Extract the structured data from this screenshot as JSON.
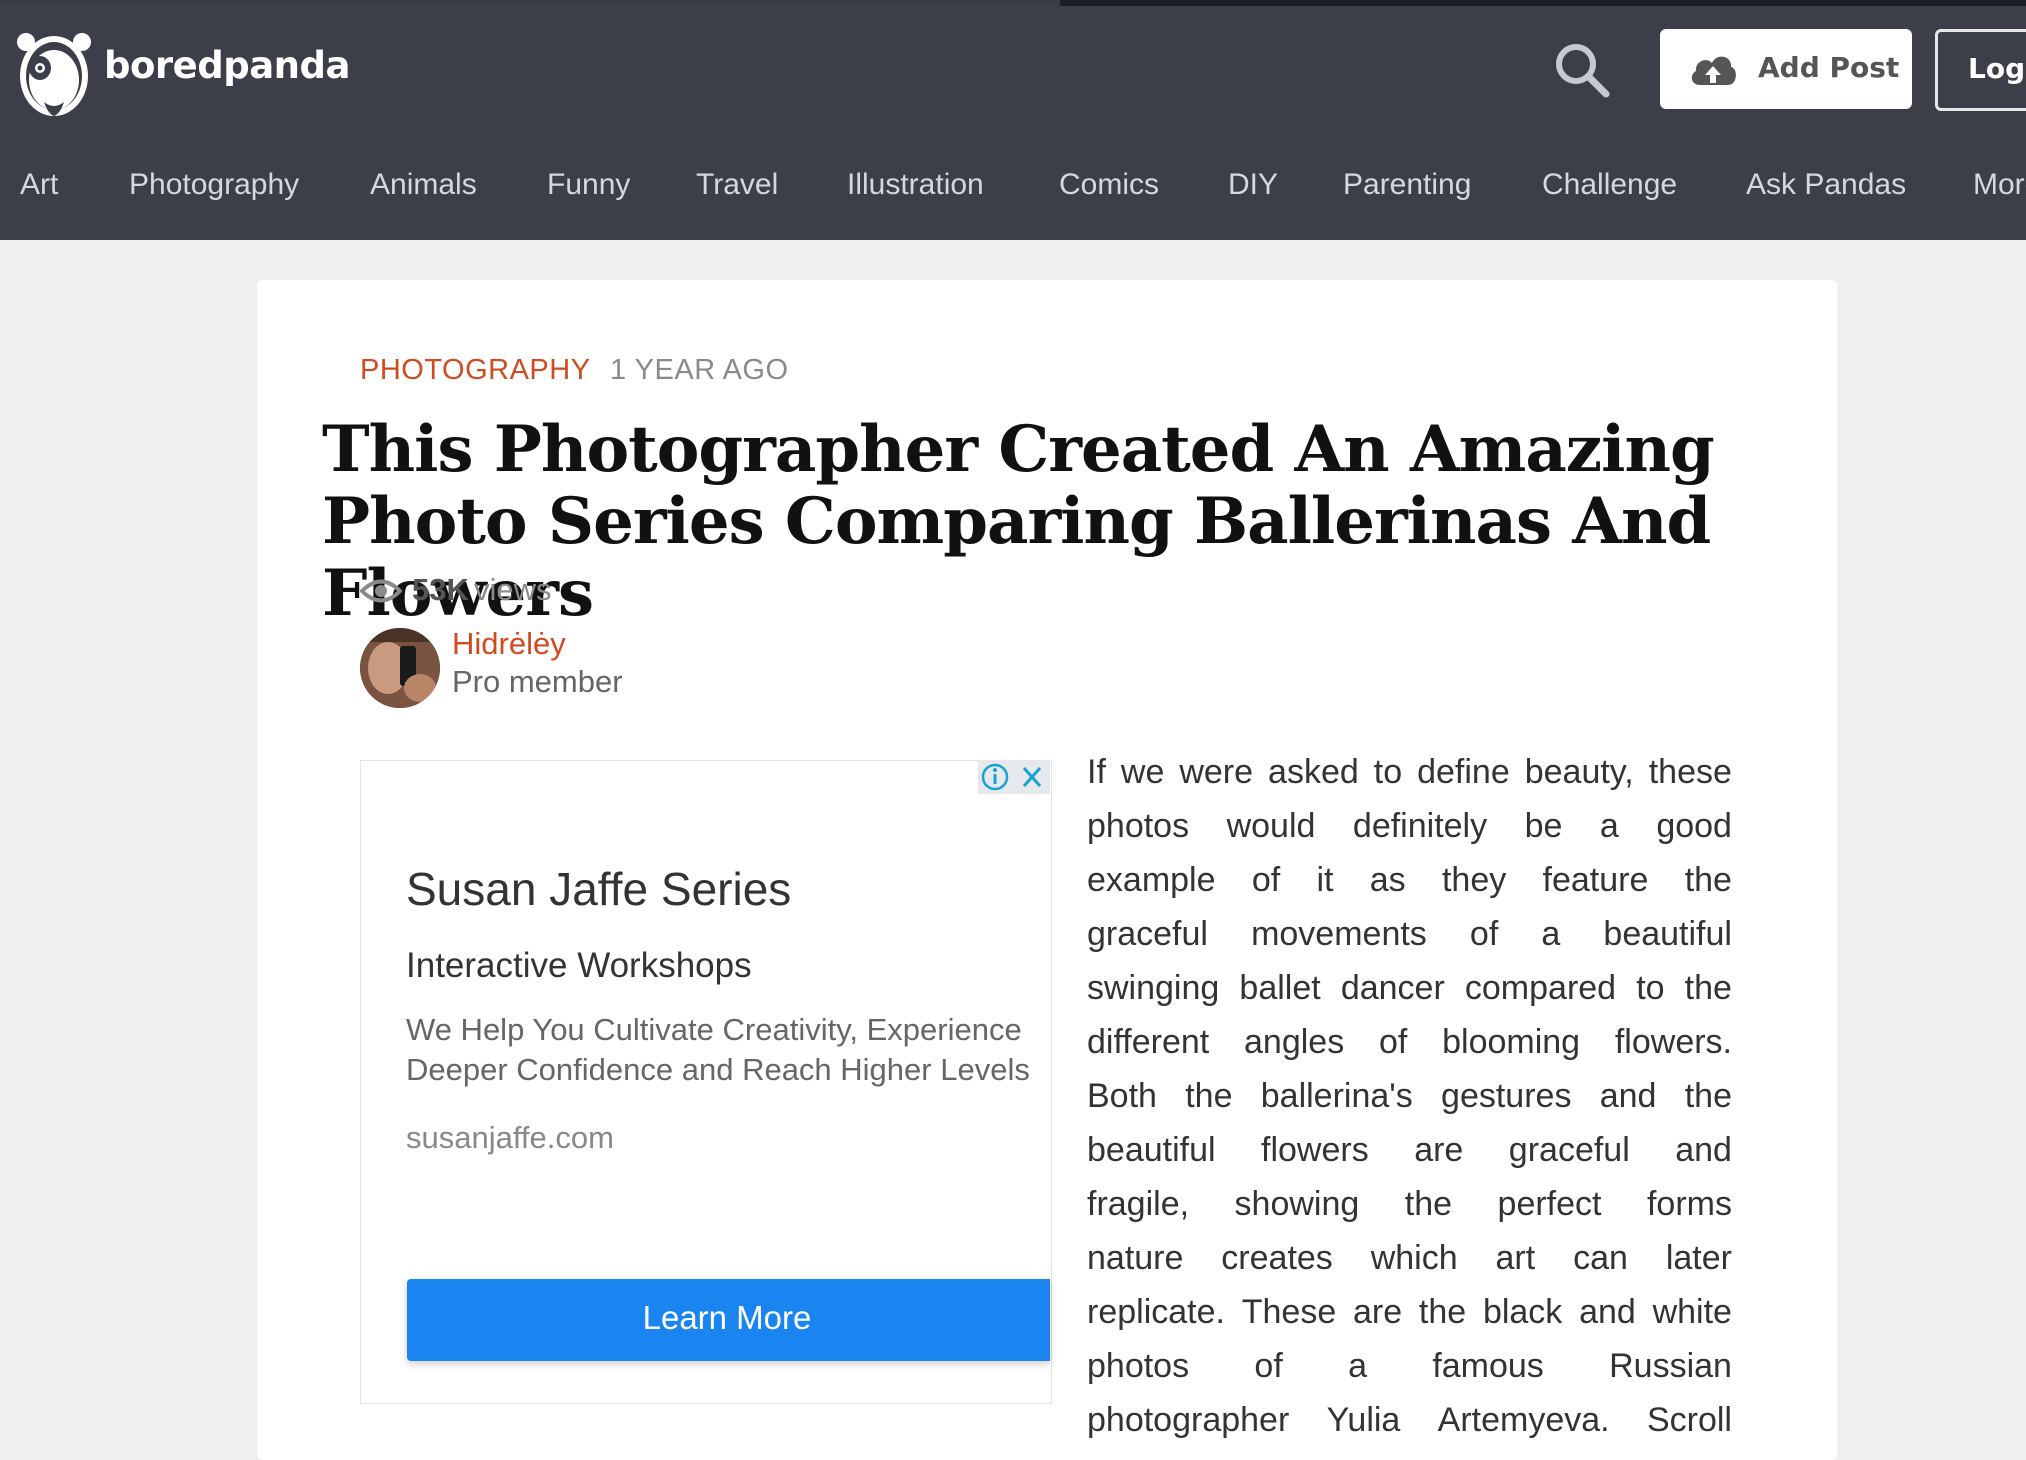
{
  "brand": {
    "name": "boredpanda"
  },
  "header": {
    "add_post_label": "Add Post",
    "login_label": "Login"
  },
  "nav": {
    "items": [
      "Art",
      "Photography",
      "Animals",
      "Funny",
      "Travel",
      "Illustration",
      "Comics",
      "DIY",
      "Parenting",
      "Challenge",
      "Ask Pandas",
      "More"
    ]
  },
  "article": {
    "category": "PHOTOGRAPHY",
    "time_ago": "1 YEAR AGO",
    "title": "This Photographer Created An Amazing Photo Series Comparing Ballerinas And Flowers",
    "views_count": "53K",
    "views_label": "views",
    "author_name": "Hidrėlėy",
    "author_role": "Pro member",
    "body_lines": [
      "If we were asked to define beauty, these",
      "photos would definitely be a good",
      "example of it as they feature the",
      "graceful movements of a beautiful",
      "swinging ballet dancer compared to the",
      "different angles of blooming flowers.",
      "Both the ballerina's gestures and the",
      "beautiful flowers are graceful and",
      "fragile, showing the perfect forms",
      "nature creates which art can later",
      "replicate. These are the black and white",
      "photos of a famous Russian",
      "photographer Yulia Artemyeva. Scroll"
    ]
  },
  "ad": {
    "title": "Susan Jaffe Series",
    "subtitle": "Interactive Workshops",
    "desc_line1": "We Help You Cultivate Creativity, Experience",
    "desc_line2": "Deeper Confidence and Reach Higher Levels",
    "url": "susanjaffe.com",
    "cta": "Learn More"
  },
  "colors": {
    "header_bg": "#3c3e4a",
    "accent": "#d04b20",
    "ad_cta": "#1a85f0"
  }
}
